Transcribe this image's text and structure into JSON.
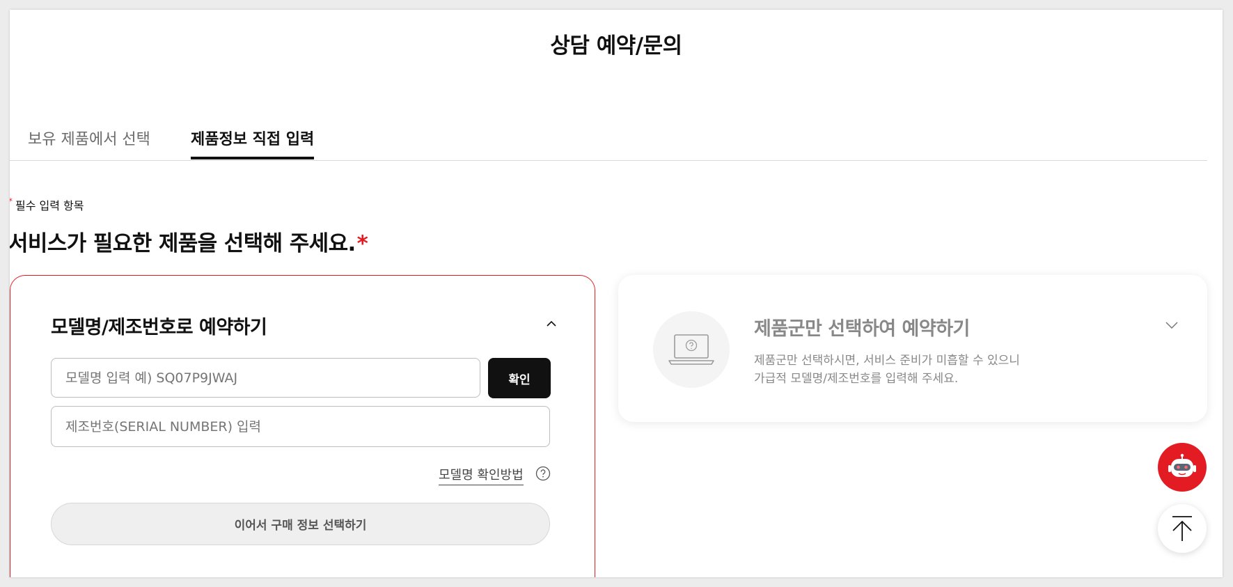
{
  "page": {
    "title": "상담 예약/문의"
  },
  "tabs": [
    {
      "label": "보유 제품에서 선택",
      "active": false
    },
    {
      "label": "제품정보 직접 입력",
      "active": true
    }
  ],
  "form": {
    "required_note": "필수 입력 항목",
    "required_star": "*",
    "section_title": "서비스가 필요한 제품을 선택해 주세요.",
    "section_star": "*"
  },
  "model_card": {
    "title": "모델명/제조번호로 예약하기",
    "expanded": true,
    "model_input": {
      "value": "",
      "placeholder": "모델명 입력 예) SQ07P9JWAJ"
    },
    "confirm_label": "확인",
    "serial_input": {
      "value": "",
      "placeholder": "제조번호(SERIAL NUMBER) 입력"
    },
    "howto_label": "모델명 확인방법",
    "continue_label": "이어서 구매 정보 선택하기"
  },
  "category_card": {
    "title": "제품군만 선택하여 예약하기",
    "expanded": false,
    "desc_line1": "제품군만 선택하시면, 서비스 준비가 미흡할 수 있으니",
    "desc_line2": "가급적 모델명/제조번호를 입력해 주세요.",
    "icon": "laptop-question-icon"
  },
  "floating": {
    "chatbot_icon": "robot-icon",
    "top_icon": "arrow-up-icon"
  },
  "colors": {
    "accent_red": "#e31c23",
    "dark_button": "#111111",
    "muted_text": "#888888"
  }
}
